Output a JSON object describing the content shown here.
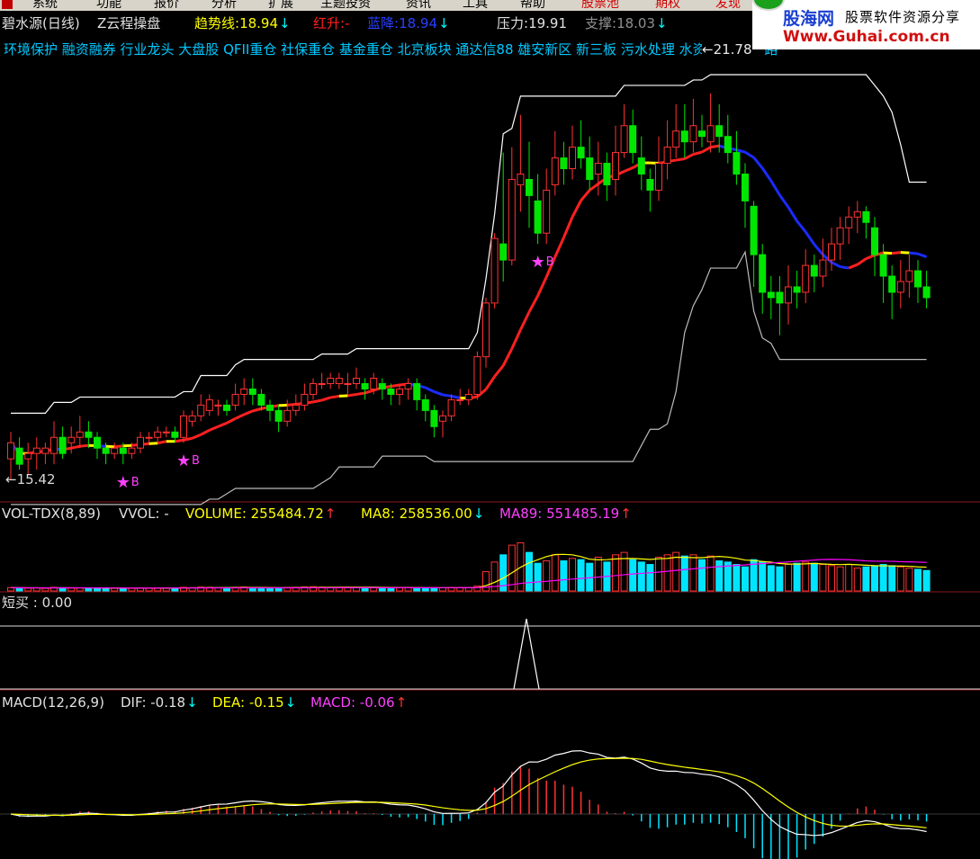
{
  "menubar": {
    "items": [
      "系统",
      "功能",
      "报价",
      "分析",
      "扩展",
      "主题投资",
      "资讯",
      "工具",
      "帮助",
      "股票池",
      "期权",
      "发现"
    ]
  },
  "watermark": {
    "brand": "股海网",
    "tagline": "股票软件资源分享",
    "url": "Www.Guhai.com.cn"
  },
  "main_panel": {
    "stock_name": "碧水源(日线)",
    "indicator_name": "Z云程操盘",
    "trend_label": "趋势线:",
    "trend_value": "18.94",
    "trend_arrow": "↓",
    "red_label": "红升:",
    "red_value": "-",
    "blue_label": "蓝降:",
    "blue_value": "18.94",
    "blue_arrow": "↓",
    "pressure_label": "压力:",
    "pressure_value": "19.91",
    "support_label": "支撑:",
    "support_value": "18.03",
    "support_arrow": "↓",
    "concepts": "环境保护 融资融券 行业龙头 大盘股 QFII重仓 社保重仓 基金重仓 北京板块 通达信88 雄安新区 新三板 污水处理 水资源 一带一路",
    "price_marker": "←15.42",
    "buy_signal": "B",
    "high_label": "←21.78"
  },
  "volume_panel": {
    "title": "VOL-TDX(8,89)",
    "vvol_label": "VVOL: -",
    "volume_label": "VOLUME: 255484.72",
    "volume_arrow": "↑",
    "ma8_label": "MA8: 258536.00",
    "ma8_arrow": "↓",
    "ma89_label": "MA89: 551485.19",
    "ma89_arrow": "↑"
  },
  "short_panel": {
    "label": "短买 : 0.00"
  },
  "macd_panel": {
    "title": "MACD(12,26,9)",
    "dif_label": "DIF: -0.18",
    "dif_arrow": "↓",
    "dea_label": "DEA: -0.15",
    "dea_arrow": "↓",
    "macd_label": "MACD: -0.06",
    "macd_arrow": "↑"
  },
  "colors": {
    "up": "#ff3232",
    "down": "#00e600",
    "trend_up": "#ff2020",
    "trend_down": "#1a2cff",
    "trend_flat": "#ffff00",
    "band": "#ffffff",
    "volume_up": "#ff3232",
    "volume_down": "#00e5ff",
    "ma8": "#ffff00",
    "ma89": "#ff00ff",
    "dif": "#ffffff",
    "dea": "#ffff00",
    "macd_pos": "#ff3232",
    "macd_neg": "#00e5ff",
    "label_yellow": "#ffff00",
    "label_cyan": "#00ffff",
    "label_magenta": "#ff40ff",
    "signal": "#ff40ff"
  },
  "chart_data": [
    {
      "type": "candlestick",
      "name": "碧水源(日线)",
      "price_range": [
        14.9,
        22.6
      ],
      "candles": [
        [
          15.4,
          15.7,
          15.2,
          15.9,
          15.0
        ],
        [
          15.6,
          15.3,
          15.5,
          15.8,
          15.2
        ],
        [
          15.4,
          15.5,
          15.3,
          15.7,
          15.1
        ],
        [
          15.5,
          15.6,
          15.3,
          15.8,
          15.2
        ],
        [
          15.5,
          15.6,
          15.4,
          15.7,
          15.3
        ],
        [
          15.5,
          15.8,
          15.4,
          16.1,
          15.3
        ],
        [
          15.8,
          15.5,
          15.6,
          16.0,
          15.4
        ],
        [
          15.7,
          15.8,
          15.6,
          16.0,
          15.5
        ],
        [
          15.8,
          15.9,
          15.7,
          16.2,
          15.6
        ],
        [
          15.9,
          15.8,
          15.7,
          16.1,
          15.6
        ],
        [
          15.8,
          15.6,
          15.5,
          15.9,
          15.4
        ],
        [
          15.6,
          15.5,
          15.4,
          15.7,
          15.3
        ],
        [
          15.5,
          15.6,
          15.5,
          15.7,
          15.4
        ],
        [
          15.6,
          15.5,
          15.4,
          15.7,
          15.3
        ],
        [
          15.5,
          15.6,
          15.5,
          15.7,
          15.4
        ],
        [
          15.6,
          15.8,
          15.5,
          15.9,
          15.5
        ],
        [
          15.8,
          15.8,
          15.7,
          15.9,
          15.7
        ],
        [
          15.8,
          15.9,
          15.7,
          16.0,
          15.7
        ],
        [
          15.9,
          15.9,
          15.8,
          16.0,
          15.8
        ],
        [
          15.9,
          15.8,
          15.8,
          16.0,
          15.7
        ],
        [
          15.8,
          16.2,
          15.7,
          16.3,
          15.7
        ],
        [
          16.1,
          16.2,
          16.1,
          16.3,
          16.0
        ],
        [
          16.2,
          16.4,
          16.1,
          16.6,
          16.1
        ],
        [
          16.3,
          16.5,
          16.3,
          16.6,
          16.2
        ],
        [
          16.4,
          16.4,
          16.3,
          16.5,
          16.2
        ],
        [
          16.4,
          16.3,
          16.2,
          16.5,
          16.2
        ],
        [
          16.4,
          16.6,
          16.3,
          16.8,
          16.3
        ],
        [
          16.6,
          16.7,
          16.5,
          16.9,
          16.4
        ],
        [
          16.7,
          16.6,
          16.5,
          16.9,
          16.4
        ],
        [
          16.6,
          16.4,
          16.3,
          16.7,
          16.3
        ],
        [
          16.4,
          16.3,
          16.2,
          16.5,
          16.1
        ],
        [
          16.3,
          16.1,
          16.0,
          16.4,
          15.9
        ],
        [
          16.1,
          16.3,
          16.1,
          16.5,
          16.0
        ],
        [
          16.3,
          16.4,
          16.3,
          16.6,
          16.2
        ],
        [
          16.4,
          16.6,
          16.4,
          16.8,
          16.3
        ],
        [
          16.6,
          16.8,
          16.5,
          16.9,
          16.5
        ],
        [
          16.8,
          16.8,
          16.7,
          17.0,
          16.7
        ],
        [
          16.8,
          16.9,
          16.8,
          17.0,
          16.7
        ],
        [
          16.8,
          16.9,
          16.8,
          17.0,
          16.7
        ],
        [
          16.8,
          16.8,
          16.7,
          17.0,
          16.6
        ],
        [
          16.8,
          16.9,
          16.8,
          17.1,
          16.7
        ],
        [
          16.8,
          16.7,
          16.6,
          16.9,
          16.5
        ],
        [
          16.7,
          16.9,
          16.7,
          17.0,
          16.6
        ],
        [
          16.8,
          16.7,
          16.6,
          16.9,
          16.5
        ],
        [
          16.7,
          16.6,
          16.5,
          16.8,
          16.4
        ],
        [
          16.6,
          16.7,
          16.5,
          16.8,
          16.4
        ],
        [
          16.7,
          16.8,
          16.6,
          16.9,
          16.5
        ],
        [
          16.8,
          16.5,
          16.4,
          16.9,
          16.3
        ],
        [
          16.5,
          16.3,
          16.2,
          16.6,
          16.1
        ],
        [
          16.3,
          16.0,
          15.9,
          16.4,
          15.8
        ],
        [
          16.1,
          16.2,
          15.9,
          16.3,
          15.8
        ],
        [
          16.2,
          16.5,
          16.2,
          16.6,
          16.1
        ],
        [
          16.5,
          16.5,
          16.4,
          16.7,
          16.4
        ],
        [
          16.5,
          16.6,
          16.5,
          16.7,
          16.4
        ],
        [
          16.6,
          17.3,
          16.6,
          17.4,
          16.5
        ],
        [
          17.3,
          18.3,
          17.2,
          18.4,
          17.1
        ],
        [
          18.3,
          19.5,
          18.3,
          19.6,
          18.2
        ],
        [
          19.4,
          19.1,
          19.0,
          21.1,
          18.7
        ],
        [
          19.1,
          20.6,
          19.0,
          21.2,
          19.0
        ],
        [
          20.5,
          20.7,
          20.3,
          21.8,
          20.0
        ],
        [
          20.6,
          20.3,
          20.2,
          21.3,
          19.7
        ],
        [
          20.2,
          19.6,
          19.5,
          20.7,
          19.4
        ],
        [
          19.6,
          20.4,
          19.6,
          20.8,
          19.4
        ],
        [
          20.5,
          21.0,
          20.4,
          21.5,
          20.3
        ],
        [
          21.0,
          20.8,
          20.7,
          21.3,
          20.5
        ],
        [
          20.8,
          21.2,
          20.8,
          21.6,
          20.6
        ],
        [
          21.2,
          21.0,
          20.9,
          21.7,
          20.8
        ],
        [
          21.0,
          20.6,
          20.5,
          21.4,
          20.4
        ],
        [
          20.7,
          20.9,
          20.6,
          21.3,
          20.3
        ],
        [
          20.9,
          20.5,
          20.4,
          21.1,
          20.2
        ],
        [
          20.6,
          21.1,
          20.5,
          21.6,
          20.3
        ],
        [
          21.1,
          21.6,
          21.1,
          22.0,
          21.0
        ],
        [
          21.6,
          21.1,
          21.0,
          21.9,
          20.9
        ],
        [
          21.0,
          20.7,
          20.6,
          21.4,
          20.4
        ],
        [
          20.6,
          20.4,
          20.3,
          20.8,
          20.0
        ],
        [
          20.4,
          20.9,
          20.3,
          21.4,
          20.2
        ],
        [
          20.9,
          21.2,
          20.8,
          21.7,
          20.6
        ],
        [
          21.2,
          21.5,
          21.1,
          22.0,
          21.0
        ],
        [
          21.5,
          21.3,
          21.2,
          22.0,
          21.0
        ],
        [
          21.3,
          21.6,
          21.2,
          22.1,
          21.1
        ],
        [
          21.5,
          21.4,
          21.3,
          21.8,
          21.2
        ],
        [
          21.3,
          21.6,
          21.2,
          22.2,
          21.1
        ],
        [
          21.6,
          21.4,
          21.3,
          22.0,
          21.1
        ],
        [
          21.4,
          21.1,
          21.0,
          21.8,
          20.9
        ],
        [
          21.1,
          20.7,
          20.6,
          21.5,
          20.5
        ],
        [
          20.7,
          20.2,
          20.0,
          20.9,
          19.7
        ],
        [
          20.1,
          19.2,
          18.8,
          20.2,
          18.6
        ],
        [
          19.2,
          18.5,
          18.3,
          19.4,
          18.1
        ],
        [
          18.5,
          18.4,
          18.2,
          18.8,
          18.0
        ],
        [
          18.5,
          18.3,
          18.1,
          18.8,
          17.7
        ],
        [
          18.3,
          18.6,
          18.0,
          19.0,
          17.9
        ],
        [
          18.6,
          18.5,
          18.3,
          18.9,
          18.2
        ],
        [
          18.5,
          19.0,
          18.4,
          19.3,
          18.3
        ],
        [
          19.0,
          18.8,
          18.6,
          19.2,
          18.5
        ],
        [
          18.8,
          19.1,
          18.7,
          19.5,
          18.6
        ],
        [
          19.1,
          19.4,
          19.0,
          19.7,
          18.9
        ],
        [
          19.4,
          19.7,
          19.3,
          19.9,
          19.1
        ],
        [
          19.7,
          19.9,
          19.6,
          20.1,
          19.4
        ],
        [
          19.9,
          20.0,
          19.7,
          20.2,
          19.6
        ],
        [
          20.0,
          19.8,
          19.6,
          20.1,
          19.5
        ],
        [
          19.7,
          19.2,
          19.0,
          19.9,
          18.8
        ],
        [
          19.2,
          18.8,
          18.6,
          19.4,
          18.3
        ],
        [
          18.8,
          18.5,
          18.2,
          19.0,
          18.0
        ],
        [
          18.5,
          18.7,
          18.3,
          19.1,
          18.2
        ],
        [
          18.7,
          18.9,
          18.6,
          19.2,
          18.4
        ],
        [
          18.9,
          18.6,
          18.5,
          19.1,
          18.3
        ],
        [
          18.6,
          18.4,
          18.3,
          18.9,
          18.2
        ]
      ]
    },
    {
      "type": "bar",
      "name": "VOL-TDX(8,89)",
      "max": 560000,
      "volumes": [
        28000,
        26000,
        24000,
        26000,
        22000,
        30000,
        27000,
        25000,
        26000,
        24000,
        22000,
        20000,
        22000,
        21000,
        23000,
        26000,
        24000,
        25000,
        26000,
        23000,
        30000,
        28000,
        32000,
        30000,
        27000,
        26000,
        30000,
        32000,
        28000,
        26000,
        25000,
        24000,
        28000,
        30000,
        33000,
        35000,
        32000,
        30000,
        31000,
        29000,
        30000,
        28000,
        30000,
        28000,
        26000,
        27000,
        30000,
        26000,
        25000,
        24000,
        26000,
        28000,
        27000,
        26000,
        40000,
        160000,
        240000,
        300000,
        380000,
        400000,
        320000,
        230000,
        250000,
        300000,
        250000,
        270000,
        260000,
        230000,
        280000,
        240000,
        300000,
        320000,
        260000,
        240000,
        220000,
        280000,
        300000,
        320000,
        290000,
        300000,
        260000,
        290000,
        250000,
        240000,
        220000,
        200000,
        260000,
        240000,
        210000,
        200000,
        220000,
        230000,
        240000,
        230000,
        220000,
        210000,
        200000,
        220000,
        190000,
        200000,
        210000,
        220000,
        210000,
        200000,
        190000,
        180000,
        170000,
        160000
      ]
    },
    {
      "type": "line",
      "name": "短买",
      "signal": "spike at the 56th bar"
    },
    {
      "type": "bar",
      "name": "MACD(12,26,9)",
      "range": [
        -1.1,
        1.8
      ]
    }
  ]
}
